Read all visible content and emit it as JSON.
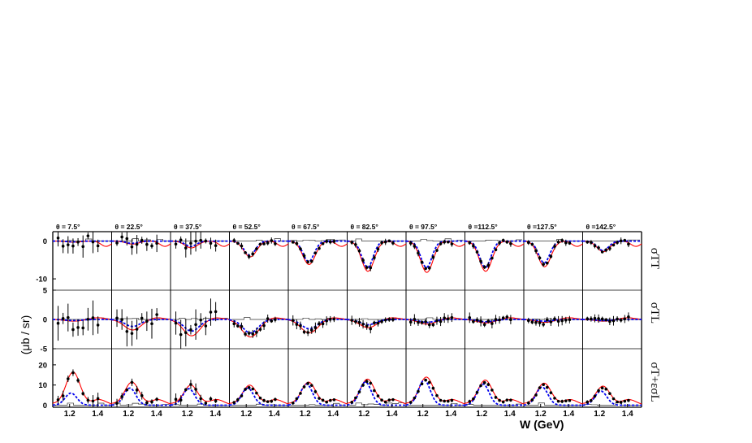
{
  "chart_data": {
    "type": "line",
    "angle_labels": [
      "θ =  7.5°",
      "θ = 22.5°",
      "θ = 37.5°",
      "θ = 52.5°",
      "θ = 67.5°",
      "θ = 82.5°",
      "θ = 97.5°",
      "θ =112.5°",
      "θ =127.5°",
      "θ =142.5°"
    ],
    "rows": [
      {
        "label": "σTT",
        "ylim": [
          -13,
          2.5
        ],
        "yticks": [
          0,
          -10
        ]
      },
      {
        "label": "σTL",
        "ylim": [
          -5,
          5
        ],
        "yticks": [
          5,
          0,
          -5
        ]
      },
      {
        "label": "σT+εσL",
        "ylim": [
          -1,
          28
        ],
        "yticks": [
          20,
          10,
          0
        ]
      }
    ],
    "xlim": [
      1.08,
      1.5
    ],
    "xticks": [
      1.2,
      1.4
    ],
    "xtick_labels": [
      "1.2",
      "1.4"
    ],
    "ylabel": "(μb / sr)",
    "xlabel": "W  (GeV)",
    "colors": {
      "data": "#000000",
      "model_full": "#ff0000",
      "model_delta": "#0000ee",
      "hist": "#000000"
    },
    "amps": {
      "row0_red": [
        0.3,
        0.8,
        1.8,
        4.2,
        6.2,
        8.0,
        8.3,
        8.0,
        6.8,
        2.8
      ],
      "row0_blue": [
        0.2,
        0.6,
        1.4,
        3.8,
        5.4,
        7.0,
        7.0,
        7.0,
        5.8,
        2.5
      ],
      "row1_red": [
        0.3,
        1.8,
        2.8,
        3.0,
        2.3,
        1.4,
        0.8,
        0.6,
        0.5,
        0.3
      ],
      "row1_blue": [
        0.2,
        1.2,
        2.0,
        2.3,
        1.6,
        0.9,
        0.5,
        0.4,
        0.3,
        0.2
      ],
      "row2_red": [
        16,
        11,
        9.5,
        9.5,
        11,
        12.5,
        13.5,
        12,
        10.5,
        9
      ],
      "row2_blue": [
        6,
        8.5,
        8.2,
        8.5,
        10.5,
        11.5,
        12.5,
        10.5,
        9,
        7
      ]
    }
  }
}
